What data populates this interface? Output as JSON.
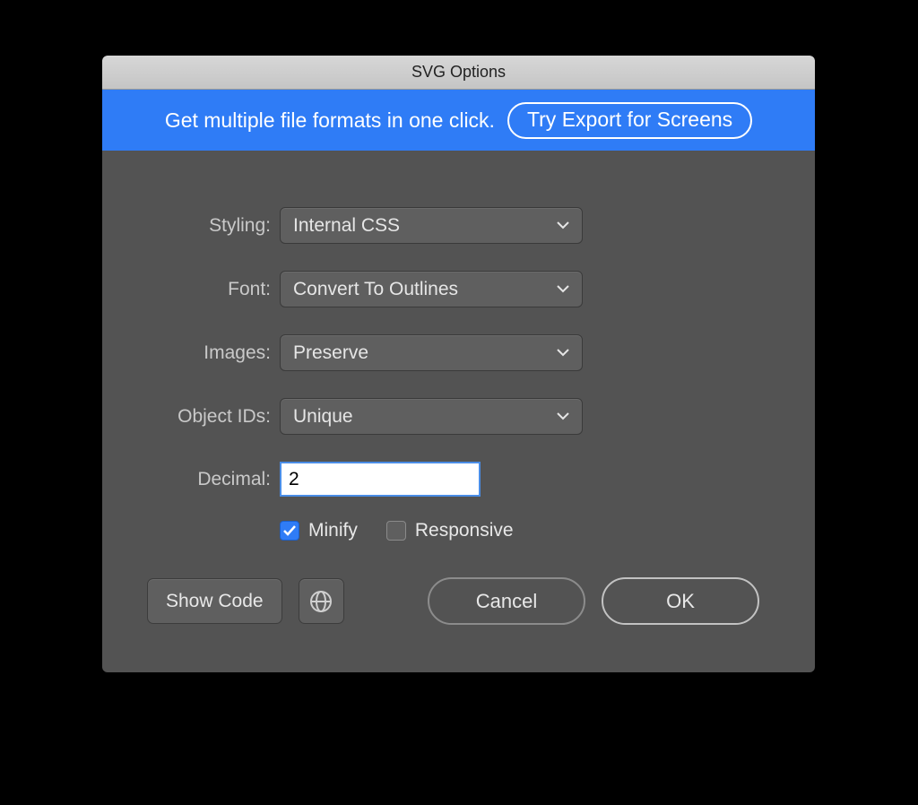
{
  "title": "SVG Options",
  "banner": {
    "text": "Get multiple file formats in one click.",
    "button": "Try Export for Screens"
  },
  "labels": {
    "styling": "Styling:",
    "font": "Font:",
    "images": "Images:",
    "object_ids": "Object IDs:",
    "decimal": "Decimal:"
  },
  "selects": {
    "styling": "Internal CSS",
    "font": "Convert To Outlines",
    "images": "Preserve",
    "object_ids": "Unique"
  },
  "decimal_value": "2",
  "checks": {
    "minify_label": "Minify",
    "responsive_label": "Responsive"
  },
  "buttons": {
    "show_code": "Show Code",
    "cancel": "Cancel",
    "ok": "OK"
  }
}
